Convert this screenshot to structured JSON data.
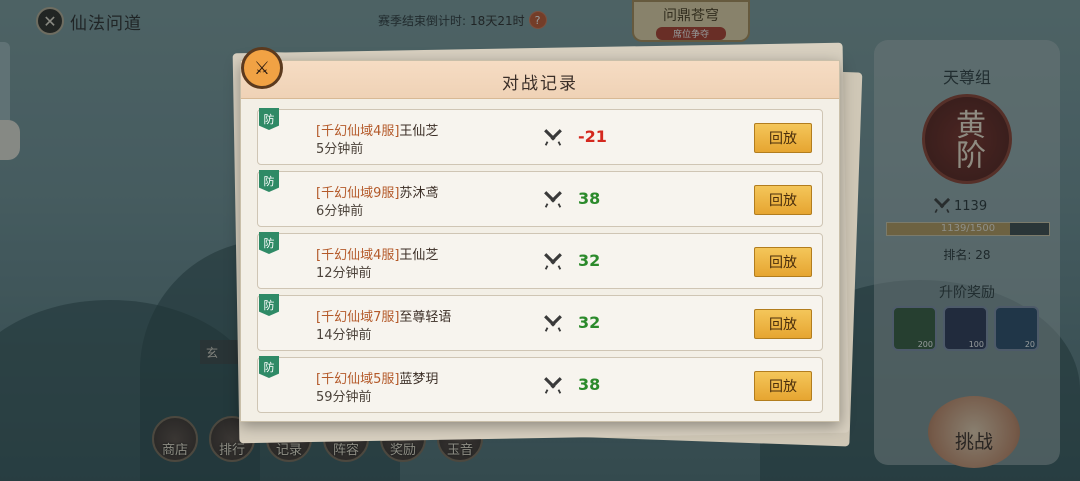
{
  "header": {
    "back_title": "仙法问道",
    "season_timer_label": "赛季结束倒计时:",
    "season_timer_value": "18天21时",
    "event_title": "问鼎苍穹",
    "event_subtitle": "席位争夺"
  },
  "right_panel": {
    "tier_name": "天尊组",
    "emblem_text": "黄阶",
    "score": "1139",
    "progress_text": "1139/1500",
    "progress_fraction": 0.759,
    "rank_label": "排名: 28",
    "reward_title": "升阶奖励",
    "rewards": [
      {
        "icon": "jade-ring-icon",
        "count": "200"
      },
      {
        "icon": "trident-icon",
        "count": "100"
      },
      {
        "icon": "crystal-icon",
        "count": "20"
      }
    ],
    "challenge_label": "挑战"
  },
  "bottom_nav": [
    {
      "label": "商店",
      "icon": "shop-icon"
    },
    {
      "label": "排行",
      "icon": "ranking-icon"
    },
    {
      "label": "记录",
      "icon": "record-icon"
    },
    {
      "label": "阵容",
      "icon": "formation-icon"
    },
    {
      "label": "奖励",
      "icon": "reward-icon"
    },
    {
      "label": "玉音",
      "icon": "voice-icon"
    }
  ],
  "modal": {
    "title": "对战记录",
    "replay_label": "回放",
    "defense_label": "防",
    "records": [
      {
        "server": "[千幻仙域4服]",
        "player": "王仙芝",
        "time": "5分钟前",
        "score": "-21",
        "negative": true
      },
      {
        "server": "[千幻仙域9服]",
        "player": "苏沐鸢",
        "time": "6分钟前",
        "score": "38",
        "negative": false
      },
      {
        "server": "[千幻仙域4服]",
        "player": "王仙芝",
        "time": "12分钟前",
        "score": "32",
        "negative": false
      },
      {
        "server": "[千幻仙域7服]",
        "player": "至尊轻语",
        "time": "14分钟前",
        "score": "32",
        "negative": false
      },
      {
        "server": "[千幻仙域5服]",
        "player": "蓝梦玥",
        "time": "59分钟前",
        "score": "38",
        "negative": false
      }
    ]
  },
  "colors": {
    "negative_score": "#d4281e",
    "positive_score": "#2b8a2b",
    "replay_button": "#f4c65a",
    "defense_tag": "#2f8a66"
  }
}
